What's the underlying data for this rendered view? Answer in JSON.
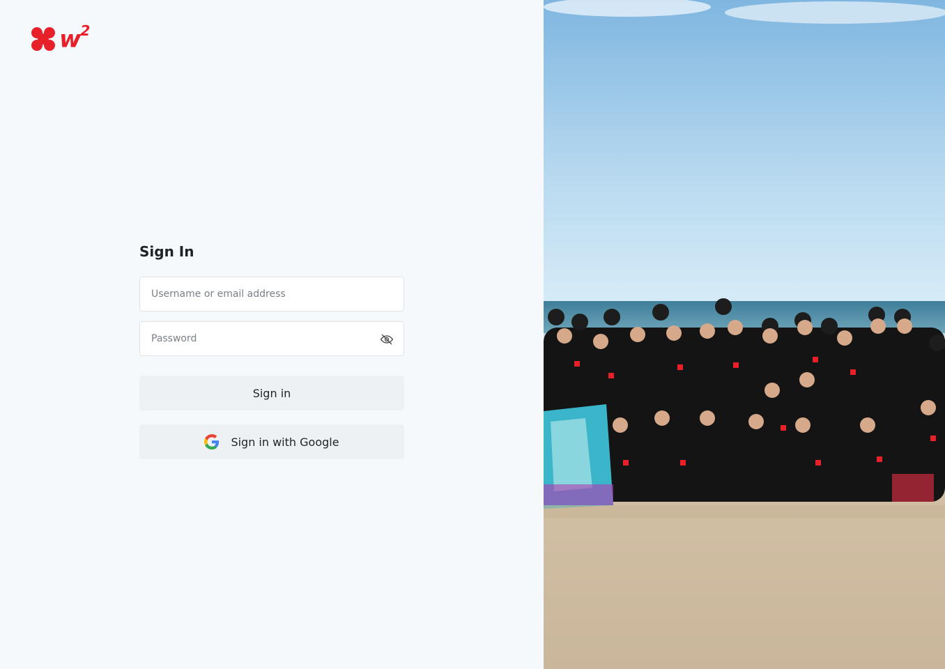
{
  "brand": {
    "logo_text": "w",
    "logo_sup": "2",
    "accent": "#e8202a"
  },
  "signin": {
    "title": "Sign In",
    "username_placeholder": "Username or email address",
    "password_placeholder": "Password",
    "signin_label": "Sign in",
    "google_label": "Sign in with Google"
  },
  "icons": {
    "password_toggle": "eye-off-icon",
    "google": "google-icon"
  }
}
